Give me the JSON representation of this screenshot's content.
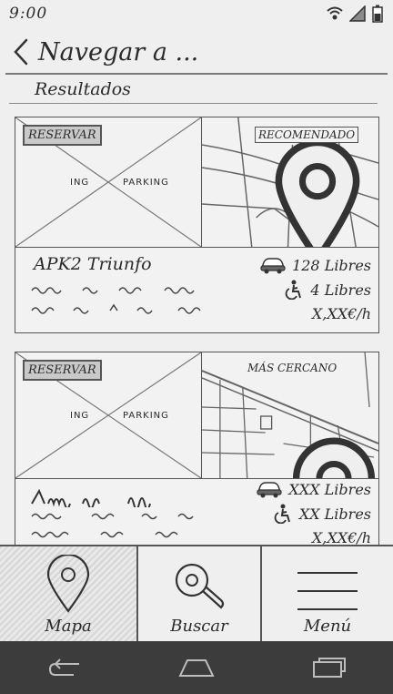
{
  "status": {
    "time": "9:00"
  },
  "appbar": {
    "title": "Navegar a ..."
  },
  "section": {
    "title": "Resultados"
  },
  "results": [
    {
      "reserve_label": "RESERVAR",
      "image_label_left": "ING",
      "image_label_right": "PARKING",
      "map_tag": "RECOMENDADO",
      "name": "APK2 Triunfo",
      "cars_free": "128 Libres",
      "bikes_free": "4 Libres",
      "price": "X,XX€/h"
    },
    {
      "reserve_label": "RESERVAR",
      "image_label_left": "ING",
      "image_label_right": "PARKING",
      "map_tag": "MÁS CERCANO",
      "name": "",
      "cars_free": "XXX Libres",
      "bikes_free": "XX Libres",
      "price": "X,XX€/h"
    }
  ],
  "bottom_nav": [
    {
      "label": "Mapa",
      "icon": "map-pin-icon",
      "active": true
    },
    {
      "label": "Buscar",
      "icon": "search-icon",
      "active": false
    },
    {
      "label": "Menú",
      "icon": "hamburger-menu-icon",
      "active": false
    }
  ],
  "system_nav": [
    "back-icon",
    "home-icon",
    "recents-icon"
  ]
}
